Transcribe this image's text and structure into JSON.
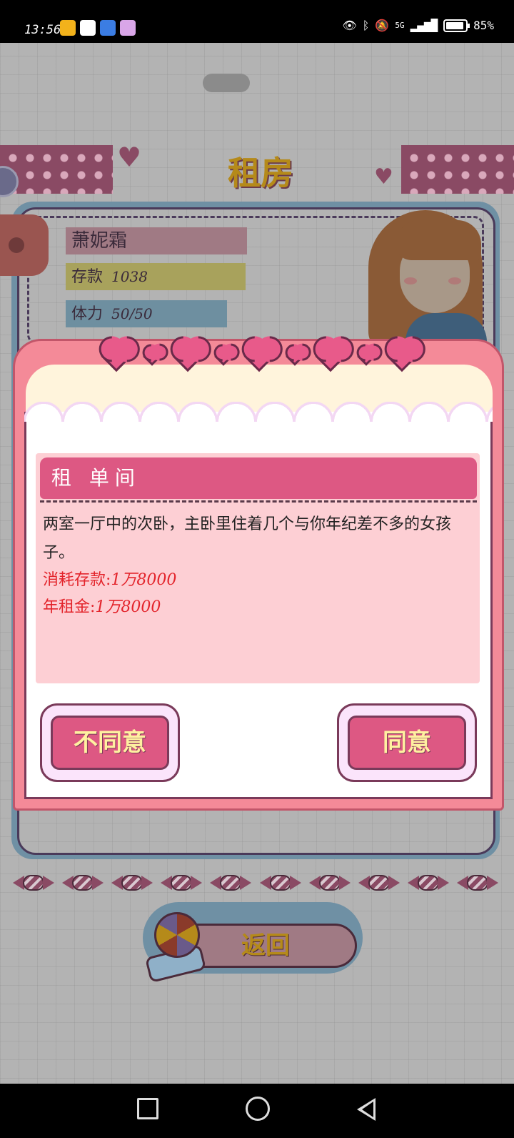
{
  "status_bar": {
    "time": "13:56",
    "network": "5G",
    "battery": "85%",
    "icons": [
      "weibo-icon",
      "upload-icon",
      "app-icon",
      "app-icon",
      "eye-icon",
      "bluetooth-icon",
      "mute-icon",
      "signal-icon",
      "battery-icon"
    ]
  },
  "screen": {
    "title": "租房",
    "player": {
      "name": "萧妮霜",
      "savings_label": "存款",
      "savings_value": "1038",
      "stamina_label": "体力",
      "stamina_value": "50/50"
    },
    "back_label": "返回"
  },
  "dialog": {
    "heading": "租 单间",
    "description": "两室一厅中的次卧，主卧里住着几个与你年纪差不多的女孩子。",
    "cost_label": "消耗存款:",
    "cost_value": "1万8000",
    "rent_label": "年租金:",
    "rent_value": "1万8000",
    "disagree_label": "不同意",
    "agree_label": "同意"
  },
  "colors": {
    "dialog_pink": "#f48a98",
    "header_pink": "#dd5883",
    "content_bg": "#fdcfd4",
    "cost_red": "#e3242b",
    "button_text": "#fff0a0"
  }
}
